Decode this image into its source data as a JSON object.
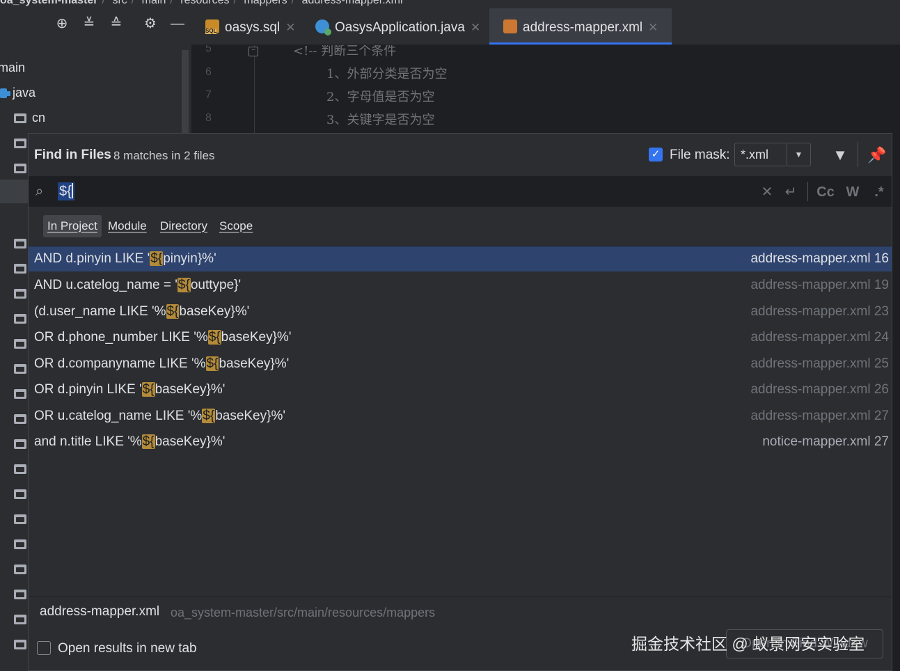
{
  "breadcrumb": {
    "project": "oa_system-master",
    "parts": [
      "src",
      "main",
      "resources",
      "mappers",
      "address-mapper.xml"
    ]
  },
  "project_tree": {
    "rows": [
      {
        "label": "main",
        "icon": "none"
      },
      {
        "label": "java",
        "icon": "folder-blue-icon"
      },
      {
        "label": "cn",
        "icon": "folder-icon"
      }
    ]
  },
  "tabs": [
    {
      "label": "oasys.sql",
      "icon": "sql-file-icon",
      "active": false
    },
    {
      "label": "OasysApplication.java",
      "icon": "java-class-icon",
      "active": false
    },
    {
      "label": "address-mapper.xml",
      "icon": "xml-file-icon",
      "active": true
    }
  ],
  "editor": {
    "lines": [
      {
        "num": "5",
        "text": "<!-- 判断三个条件"
      },
      {
        "num": "6",
        "text": "1、外部分类是否为空"
      },
      {
        "num": "7",
        "text": "2、字母值是否为空"
      },
      {
        "num": "8",
        "text": "3、关键字是否为空"
      }
    ]
  },
  "find": {
    "title": "Find in Files",
    "count": "8 matches in 2 files",
    "file_mask_label": "File mask:",
    "file_mask_checked": true,
    "file_mask_value": "*.xml",
    "query": "${",
    "options": {
      "case": "Cc",
      "words": "W",
      "regex": ".*"
    },
    "scopes": [
      {
        "label": "In Project",
        "active": true
      },
      {
        "label": "Module",
        "active": false
      },
      {
        "label": "Directory",
        "active": false
      },
      {
        "label": "Scope",
        "active": false
      }
    ],
    "results": [
      {
        "pre": "AND d.pinyin LIKE '",
        "match": "${",
        "post": "pinyin}%'",
        "file": "address-mapper.xml",
        "line": "16",
        "selected": true
      },
      {
        "pre": "AND u.catelog_name = '",
        "match": "${",
        "post": "outtype}'",
        "file": "address-mapper.xml",
        "line": "19",
        "selected": false
      },
      {
        "pre": "(d.user_name LIKE '%",
        "match": "${",
        "post": "baseKey}%'",
        "file": "address-mapper.xml",
        "line": "23",
        "selected": false
      },
      {
        "pre": "OR d.phone_number LIKE '%",
        "match": "${",
        "post": "baseKey}%'",
        "file": "address-mapper.xml",
        "line": "24",
        "selected": false
      },
      {
        "pre": "OR d.companyname LIKE '%",
        "match": "${",
        "post": "baseKey}%'",
        "file": "address-mapper.xml",
        "line": "25",
        "selected": false
      },
      {
        "pre": "OR d.pinyin LIKE '",
        "match": "${",
        "post": "baseKey}%'",
        "file": "address-mapper.xml",
        "line": "26",
        "selected": false
      },
      {
        "pre": "OR u.catelog_name LIKE '%",
        "match": "${",
        "post": "baseKey}%'",
        "file": "address-mapper.xml",
        "line": "27",
        "selected": false
      },
      {
        "pre": "and n.title LIKE '%",
        "match": "${",
        "post": "baseKey}%'",
        "file": "notice-mapper.xml",
        "line": "27",
        "selected": false
      }
    ],
    "preview_file": "address-mapper.xml",
    "preview_path": "oa_system-master/src/main/resources/mappers",
    "open_new_tab_label": "Open results in new tab",
    "open_new_tab_checked": false,
    "open_button_label": "Open in Find Window"
  },
  "watermark": "掘金技术社区 @ 蚁景网安实验室",
  "colors": {
    "accent": "#3574f0",
    "selection": "#2e436e",
    "match_highlight": "#b38b39",
    "panel_bg": "#2b2d30",
    "editor_bg": "#1e1f22"
  }
}
